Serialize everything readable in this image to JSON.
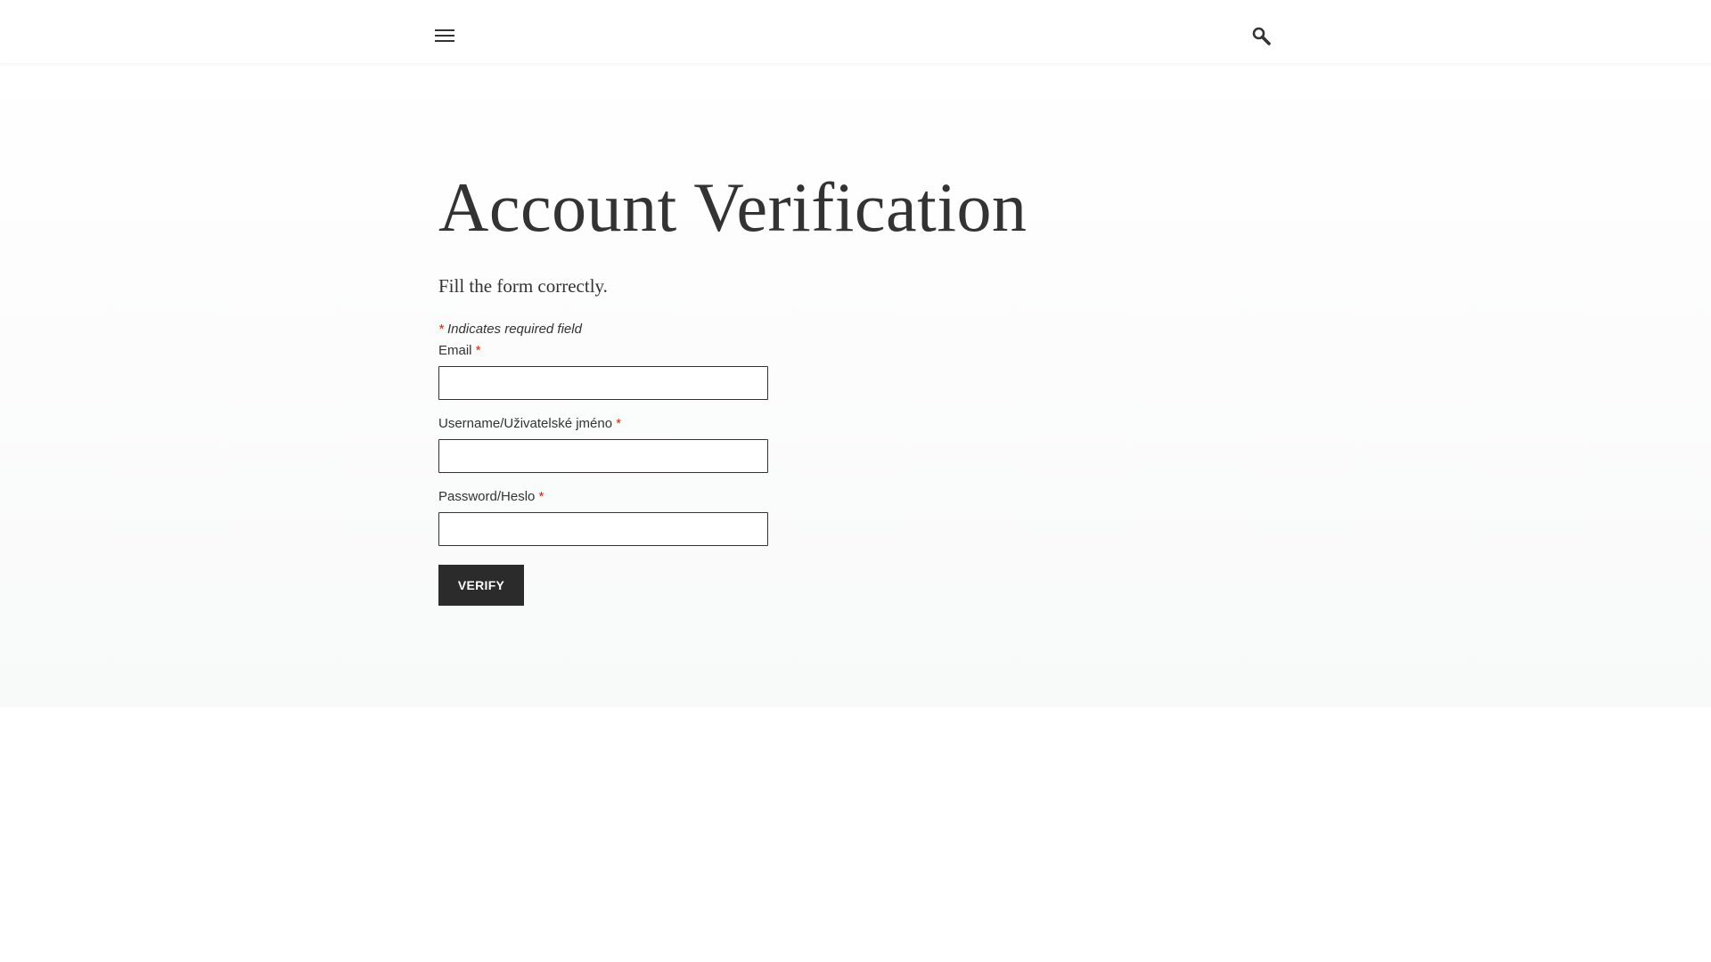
{
  "header": {
    "menu_icon": "hamburger-menu-icon",
    "search_icon": "search-icon"
  },
  "page": {
    "title": "Account Verification",
    "intro": "Fill the form correctly."
  },
  "form": {
    "required_note_asterisk": "*",
    "required_note_text": " Indicates required field",
    "fields": [
      {
        "label": "Email",
        "required_mark": "*",
        "value": "",
        "placeholder": ""
      },
      {
        "label": "Username/Uživatelské jméno",
        "required_mark": "*",
        "value": "",
        "placeholder": ""
      },
      {
        "label": "Password/Heslo",
        "required_mark": "*",
        "value": "",
        "placeholder": ""
      }
    ],
    "submit_label": "VERIFY"
  },
  "colors": {
    "text": "#333333",
    "required": "#c02b0a",
    "button_bg": "#2b2b2b",
    "button_text": "#ffffff"
  }
}
